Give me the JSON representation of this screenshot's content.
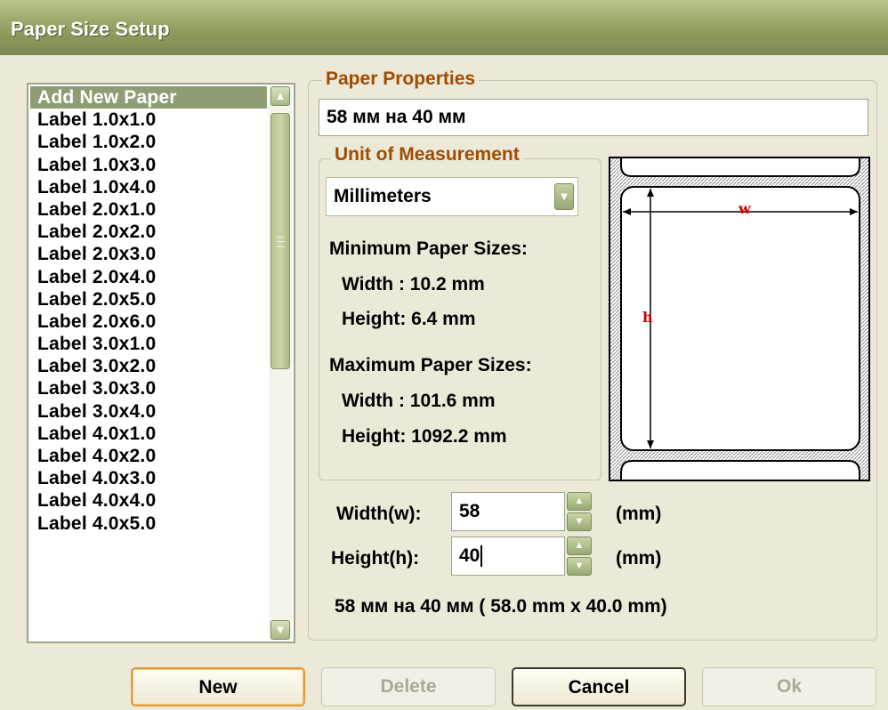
{
  "window": {
    "title": "Paper Size Setup"
  },
  "paper_list": {
    "items": [
      "Add New Paper",
      "Label 1.0x1.0",
      "Label 1.0x2.0",
      "Label 1.0x3.0",
      "Label 1.0x4.0",
      "Label 2.0x1.0",
      "Label 2.0x2.0",
      "Label 2.0x3.0",
      "Label 2.0x4.0",
      "Label 2.0x5.0",
      "Label 2.0x6.0",
      "Label 3.0x1.0",
      "Label 3.0x2.0",
      "Label 3.0x3.0",
      "Label 3.0x4.0",
      "Label 4.0x1.0",
      "Label 4.0x2.0",
      "Label 4.0x3.0",
      "Label 4.0x4.0",
      "Label 4.0x5.0"
    ],
    "selected_index": 0
  },
  "paper_properties": {
    "legend": "Paper Properties",
    "name_value": "58 мм на 40 мм"
  },
  "unit": {
    "legend": "Unit of Measurement",
    "selected": "Millimeters",
    "min_title": "Minimum Paper Sizes:",
    "min_width": "Width : 10.2 mm",
    "min_height": "Height: 6.4 mm",
    "max_title": "Maximum Paper Sizes:",
    "max_width": "Width : 101.6 mm",
    "max_height": "Height: 1092.2 mm"
  },
  "diagram": {
    "w_label": "w",
    "h_label": "h"
  },
  "size": {
    "width_label": "Width(w):",
    "width_value": "58",
    "height_label": "Height(h):",
    "height_value": "40",
    "unit": "(mm)",
    "summary": "58 мм на 40 мм ( 58.0 mm x 40.0 mm)"
  },
  "buttons": {
    "new": "New",
    "delete": "Delete",
    "cancel": "Cancel",
    "ok": "Ok"
  },
  "colors": {
    "accent_legend": "#a04c00",
    "selection": "#8f9d74",
    "title_bar": "#8e9e5e"
  }
}
